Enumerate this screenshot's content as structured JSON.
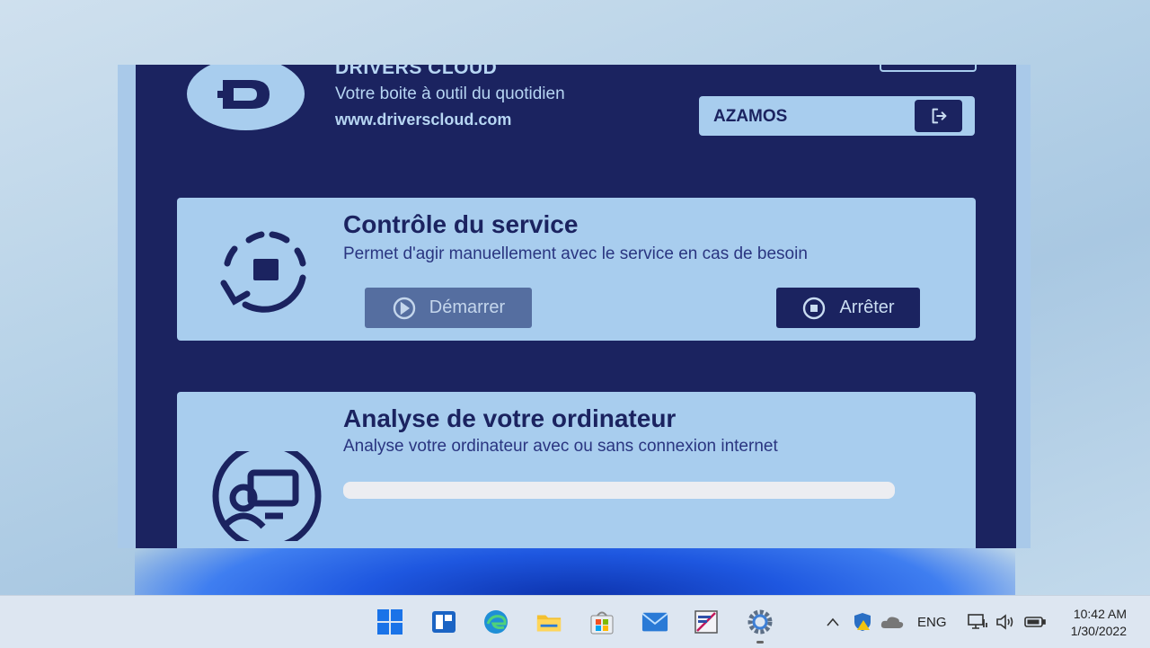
{
  "brand": {
    "name": "DRIVERS CLOUD",
    "tagline": "Votre boite à outil du quotidien",
    "url": "www.driverscloud.com"
  },
  "user": {
    "name": "AZAMOS",
    "logout_icon": "logout-icon"
  },
  "service_card": {
    "title": "Contrôle du service",
    "subtitle": "Permet d'agir manuellement avec le service en cas de besoin",
    "icon": "service-refresh-icon",
    "start_label": "Démarrer",
    "stop_label": "Arrêter"
  },
  "analysis_card": {
    "title": "Analyse de votre ordinateur",
    "subtitle": "Analyse votre ordinateur avec ou sans connexion internet",
    "icon": "computer-scan-icon",
    "progress": 0
  },
  "taskbar": {
    "language": "ENG",
    "time": "10:42 AM",
    "date": "1/30/2022",
    "apps": [
      "start-icon",
      "widgets-icon",
      "edge-icon",
      "file-explorer-icon",
      "store-icon",
      "mail-icon",
      "app-icon",
      "settings-icon"
    ]
  },
  "colors": {
    "app_background": "#1b2360",
    "card_background": "#a8cdee",
    "accent_dark": "#1b2360",
    "disabled_button": "#556ea0"
  }
}
